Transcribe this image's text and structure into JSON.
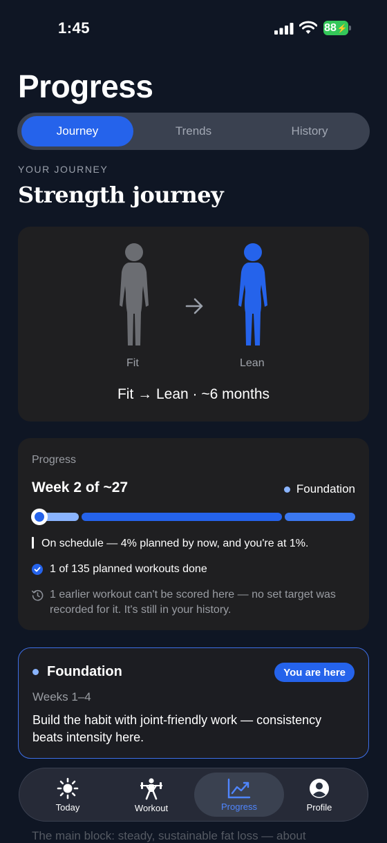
{
  "status": {
    "time": "1:45",
    "battery": "88"
  },
  "page_title": "Progress",
  "segments": [
    {
      "label": "Journey",
      "active": true
    },
    {
      "label": "Trends",
      "active": false
    },
    {
      "label": "History",
      "active": false
    }
  ],
  "journey": {
    "kicker": "YOUR JOURNEY",
    "title": "Strength journey",
    "from_label": "Fit",
    "to_label": "Lean",
    "summary": "Fit → Lean · ~6 months"
  },
  "progress": {
    "section_label": "Progress",
    "week_text": "Week 2 of ~27",
    "phase_label": "Foundation",
    "schedule_text": "On schedule — 4% planned by now, and you're at 1%.",
    "workouts_text": "1 of 135 planned workouts done",
    "note_text": "1 earlier workout can't be scored here — no set target was recorded for it. It's still in your history."
  },
  "phase_card": {
    "title": "Foundation",
    "badge": "You are here",
    "weeks": "Weeks 1–4",
    "description": "Build the habit with joint-friendly work — consistency beats intensity here."
  },
  "behind_text": "The main block: steady, sustainable fat loss — about",
  "tabbar": [
    {
      "label": "Today",
      "icon": "sun-icon",
      "active": false
    },
    {
      "label": "Workout",
      "icon": "weightlifter-icon",
      "active": false
    },
    {
      "label": "Progress",
      "icon": "chart-icon",
      "active": true
    },
    {
      "label": "Profile",
      "icon": "person-icon",
      "active": false
    }
  ],
  "colors": {
    "accent": "#2563eb",
    "background": "#0f1624",
    "card": "#1f1f21",
    "battery": "#34c759"
  }
}
